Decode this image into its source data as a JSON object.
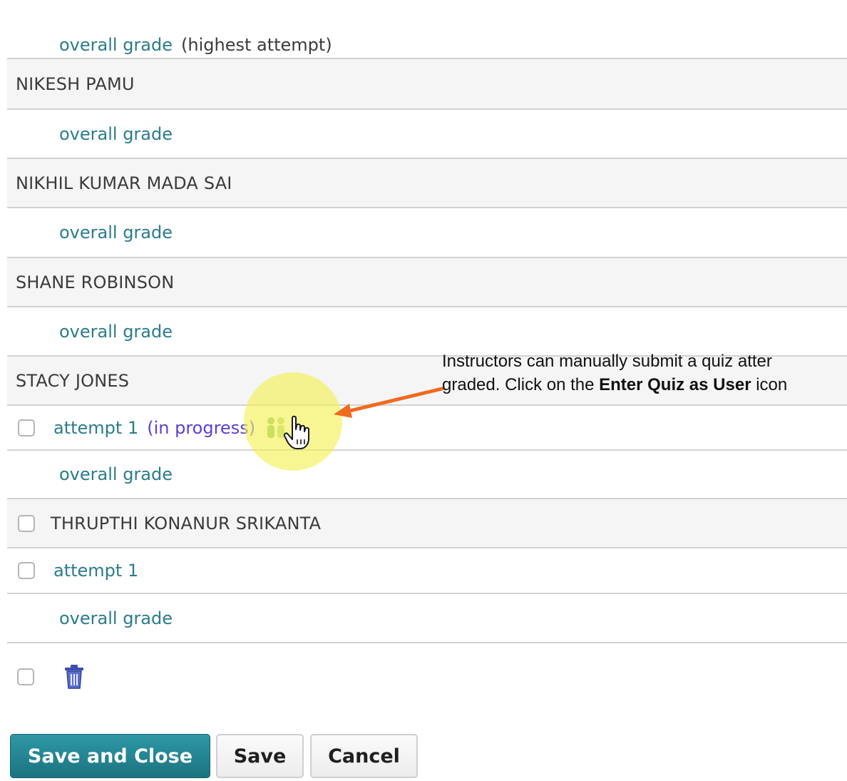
{
  "grades": {
    "top_partial_label": "overall grade",
    "top_partial_note": "(highest attempt)",
    "rows": [
      {
        "kind": "user",
        "label": "NIKESH PAMU"
      },
      {
        "kind": "grade",
        "label": "overall grade"
      },
      {
        "kind": "user",
        "label": "NIKHIL KUMAR MADA SAI"
      },
      {
        "kind": "grade",
        "label": "overall grade"
      },
      {
        "kind": "user",
        "label": "SHANE ROBINSON"
      },
      {
        "kind": "grade",
        "label": "overall grade"
      },
      {
        "kind": "user",
        "label": "STACY JONES"
      },
      {
        "kind": "attempt",
        "label": "attempt 1",
        "status": "(in progress)"
      },
      {
        "kind": "grade",
        "label": "overall grade"
      },
      {
        "kind": "user",
        "label": "THRUPTHI KONANUR SRIKANTA"
      },
      {
        "kind": "attempt",
        "label": "attempt 1"
      },
      {
        "kind": "grade",
        "label": "overall grade"
      }
    ]
  },
  "callout": {
    "line1": "Instructors can manually submit a quiz atter",
    "line2_prefix": "graded. Click on the ",
    "line2_bold": "Enter Quiz as User",
    "line2_suffix": " icon"
  },
  "actions": {
    "save_close": "Save and Close",
    "save": "Save",
    "cancel": "Cancel"
  },
  "icons": {
    "enter_quiz": "enter-quiz-as-user-icon",
    "delete": "trash-icon"
  },
  "colors": {
    "link": "#2a7c8c",
    "status": "#5b3fd6",
    "primary_button": "#2389a0",
    "arrow": "#f06a1e",
    "highlight": "#f4f050"
  }
}
